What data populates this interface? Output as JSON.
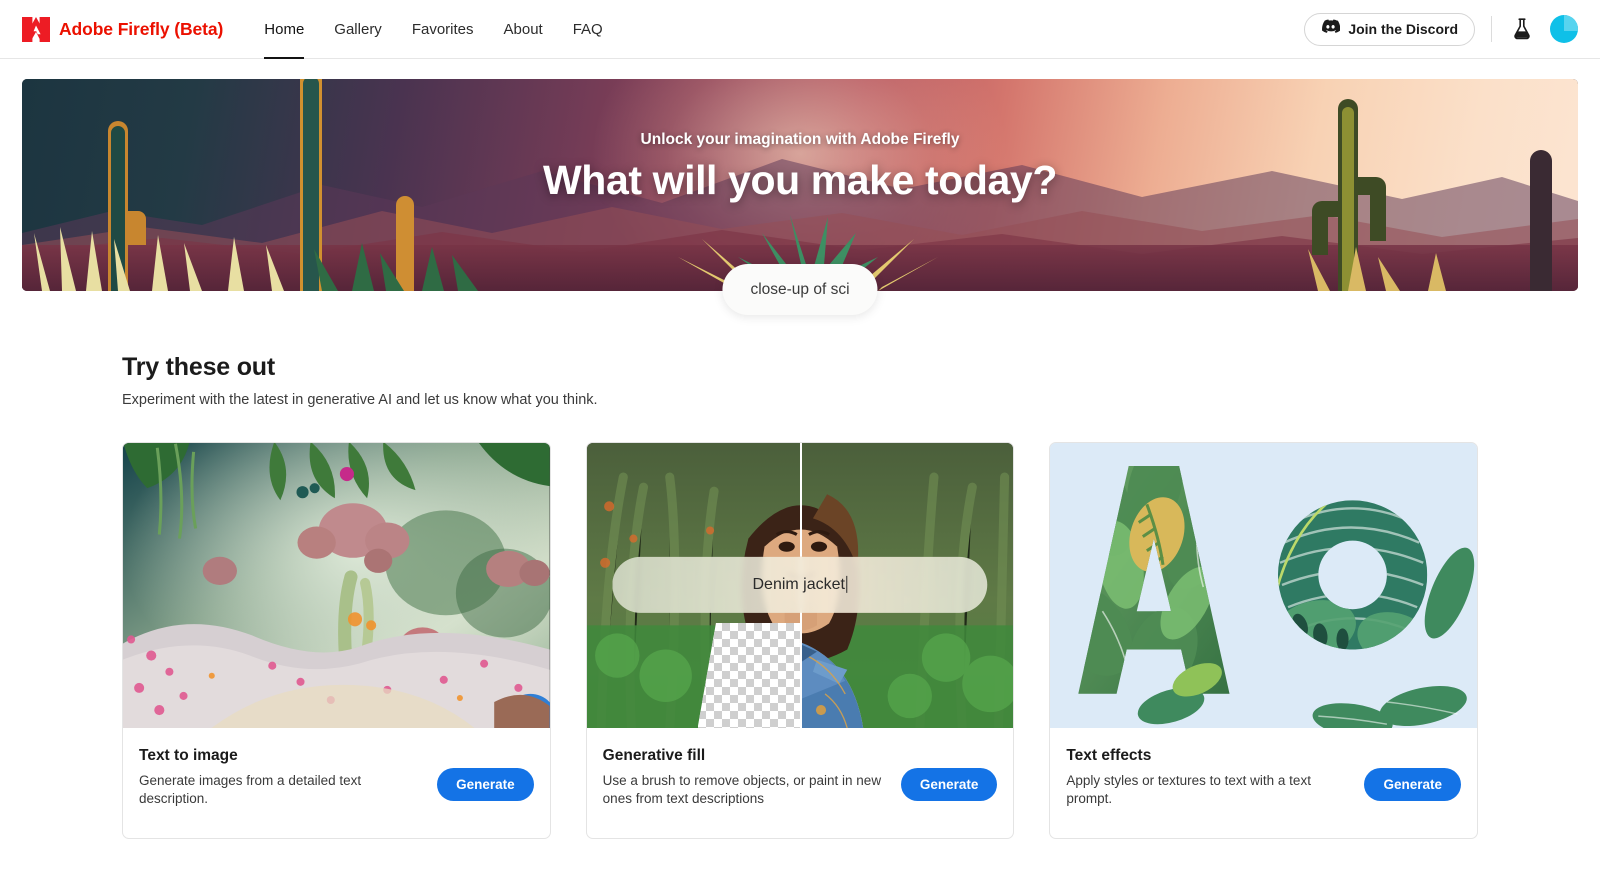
{
  "header": {
    "logo_icon": "adobe-a-logo",
    "brand": "Adobe Firefly (Beta)",
    "nav": [
      {
        "label": "Home",
        "active": true
      },
      {
        "label": "Gallery",
        "active": false
      },
      {
        "label": "Favorites",
        "active": false
      },
      {
        "label": "About",
        "active": false
      },
      {
        "label": "FAQ",
        "active": false
      }
    ],
    "discord": {
      "label": "Join the Discord",
      "icon": "discord-icon"
    },
    "lab_icon": "flask-icon",
    "avatar_icon": "user-avatar",
    "brand_color": "#eb1000"
  },
  "hero": {
    "kicker": "Unlock your imagination with Adobe Firefly",
    "title": "What will you make today?",
    "prompt_pill": "close-up of sci",
    "alt": "Stylized desert landscape at sunset with saguaro cacti and layered mountains"
  },
  "section": {
    "title": "Try these out",
    "subtitle": "Experiment with the latest in generative AI and let us know what you think."
  },
  "cards": [
    {
      "id": "text-to-image",
      "title": "Text to image",
      "description": "Generate images from a detailed text description.",
      "button": "Generate",
      "media_alt": "Surreal lush fantasy garden with oversized pink mushroom flowers and blossoms"
    },
    {
      "id": "generative-fill",
      "title": "Generative fill",
      "description": "Use a brush to remove objects, or paint in new ones from text descriptions",
      "button": "Generate",
      "media_alt": "Split before/after portrait of a woman; left half transparent checkerboard, right half wearing a denim jacket",
      "overlay_prompt": "Denim jacket"
    },
    {
      "id": "text-effects",
      "title": "Text effects",
      "description": "Apply styles or textures to text with a text prompt.",
      "button": "Generate",
      "media_alt": "Letters A and o composed of tropical green leaves on a pale blue background"
    }
  ],
  "colors": {
    "accent_blue": "#1473e6",
    "adobe_red": "#eb1000",
    "avatar_cyan": "#0fc0e8",
    "card_border": "#e4e4e4"
  }
}
